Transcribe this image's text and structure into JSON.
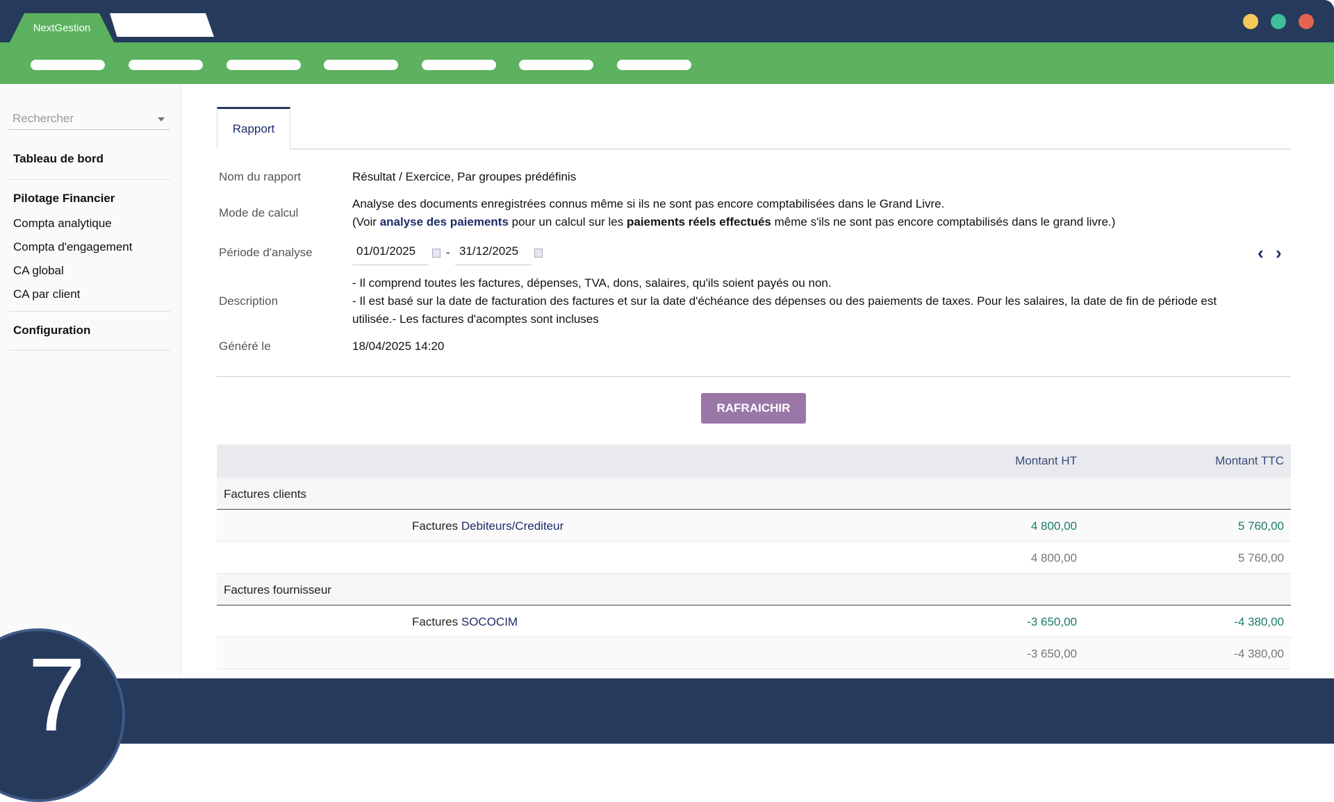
{
  "app": {
    "tab_label": "NextGestion",
    "colors": {
      "dark": "#263a5c",
      "green": "#5cb25f",
      "accent": "#9b77a8"
    }
  },
  "sidebar": {
    "search_placeholder": "Rechercher",
    "dashboard": "Tableau de bord",
    "section1": "Pilotage Financier",
    "items": [
      "Compta analytique",
      "Compta d'engagement",
      "CA global",
      "CA par client"
    ],
    "section2": "Configuration"
  },
  "tabs": {
    "active": "Rapport"
  },
  "report": {
    "name_label": "Nom du rapport",
    "name": "Résultat / Exercice, Par groupes prédéfinis",
    "mode_label": "Mode de calcul",
    "mode_line1": "Analyse des documents enregistrées connus même si ils ne sont pas encore comptabilisées dans le Grand Livre.",
    "mode_line2_a": "(Voir ",
    "mode_line2_link": "analyse des paiements",
    "mode_line2_b": " pour un calcul sur les ",
    "mode_line2_bold": "paiements réels effectués",
    "mode_line2_c": " même s'ils ne sont pas encore comptabilisés dans le grand livre.)",
    "period_label": "Période d'analyse",
    "date_from": "01/01/2025",
    "date_sep": "-",
    "date_to": "31/12/2025",
    "desc_label": "Description",
    "desc_line1": "- Il comprend toutes les factures, dépenses, TVA, dons, salaires, qu'ils soient payés ou non.",
    "desc_line2": "- Il est basé sur la date de facturation des factures et sur la date d'échéance des dépenses ou des paiements de taxes. Pour les salaires, la date de fin de période est utilisée.- Les factures d'acomptes sont incluses",
    "generated_label": "Généré le",
    "generated": "18/04/2025 14:20",
    "refresh": "RAFRAICHIR"
  },
  "table": {
    "headers": {
      "ht": "Montant HT",
      "ttc": "Montant TTC"
    },
    "groups": [
      {
        "title": "Factures clients",
        "row_prefix": "Factures ",
        "row_link": "Debiteurs/Crediteur",
        "ht": "4 800,00",
        "ttc": "5 760,00",
        "total_ht": "4 800,00",
        "total_ttc": "5 760,00"
      },
      {
        "title": "Factures fournisseur",
        "row_prefix": "Factures ",
        "row_link": "SOCOCIM",
        "ht": "-3 650,00",
        "ttc": "-4 380,00",
        "total_ht": "-3 650,00",
        "total_ttc": "-4 380,00"
      }
    ]
  },
  "step_number": "7"
}
